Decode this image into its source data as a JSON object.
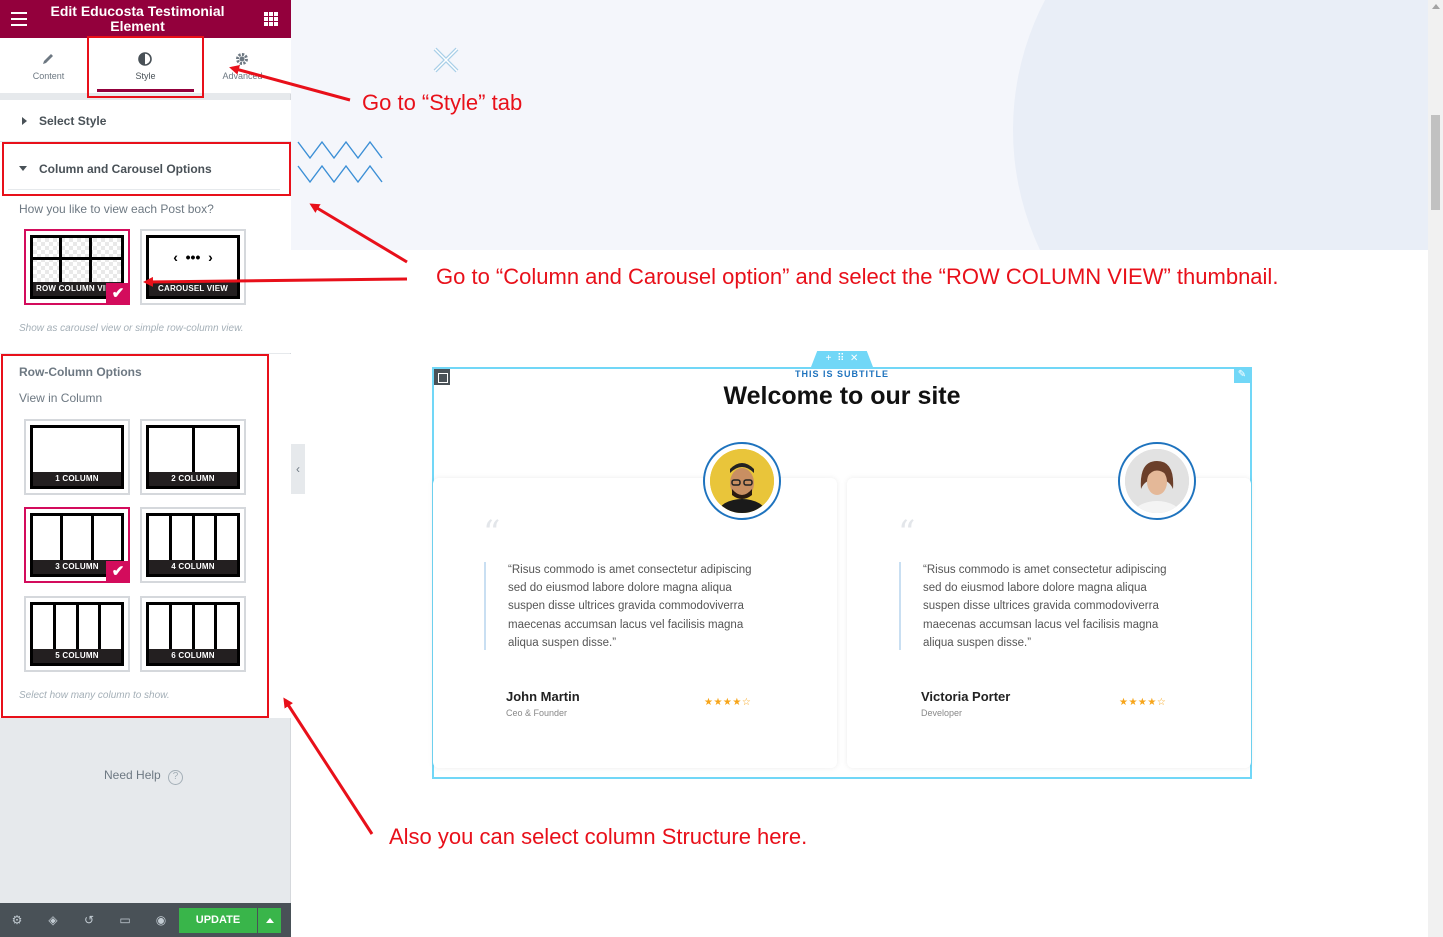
{
  "panel": {
    "title": "Edit Educosta Testimonial Element",
    "tabs": [
      {
        "label": "Content",
        "icon": "pencil-icon"
      },
      {
        "label": "Style",
        "icon": "half-circle-icon"
      },
      {
        "label": "Advanced",
        "icon": "gear-icon"
      }
    ],
    "select_style_label": "Select Style",
    "column_carousel_label": "Column and Carousel Options",
    "view_question": "How you like to view each Post box?",
    "view_options": [
      {
        "label": "ROW COLUMN VIEW",
        "selected": true
      },
      {
        "label": "CAROUSEL VIEW",
        "selected": false
      }
    ],
    "view_hint": "Show as carousel view or simple row-column view.",
    "row_column_label": "Row-Column Options",
    "view_in_column_label": "View in Column",
    "column_options": [
      {
        "label": "1 COLUMN",
        "cols": 1,
        "selected": false
      },
      {
        "label": "2 COLUMN",
        "cols": 2,
        "selected": false
      },
      {
        "label": "3 COLUMN",
        "cols": 3,
        "selected": true
      },
      {
        "label": "4 COLUMN",
        "cols": 4,
        "selected": false
      },
      {
        "label": "5 COLUMN",
        "cols": 4,
        "selected": false
      },
      {
        "label": "6 COLUMN",
        "cols": 4,
        "selected": false
      }
    ],
    "column_hint": "Select how many column to show.",
    "need_help": "Need Help",
    "update_label": "UPDATE",
    "footer_icons": [
      "settings-icon",
      "layers-icon",
      "history-icon",
      "responsive-icon",
      "eye-icon"
    ]
  },
  "preview": {
    "subtitle": "THIS IS SUBTITLE",
    "heading": "Welcome to our site",
    "testimonials": [
      {
        "quote": "“Risus commodo is amet consectetur adipiscing sed do eiusmod labore dolore magna aliqua suspen disse ultrices gravida commodoviverra maecenas accumsan lacus vel facilisis magna aliqua suspen disse.”",
        "name": "John Martin",
        "role": "Ceo & Founder",
        "rating": 4
      },
      {
        "quote": "“Risus commodo is amet consectetur adipiscing sed do eiusmod labore dolore magna aliqua suspen disse ultrices gravida commodoviverra maecenas accumsan lacus vel facilisis magna aliqua suspen disse.”",
        "name": "Victoria Porter",
        "role": "Developer",
        "rating": 4
      }
    ],
    "stars_text": "★★★★☆"
  },
  "annotations": {
    "style_tab": "Go  to “Style” tab",
    "column_option": "Go to “Column and Carousel option” and select the “ROW COLUMN VIEW” thumbnail.",
    "column_structure": "Also you can select column Structure here."
  },
  "colors": {
    "header": "#93003c",
    "selected": "#d30c5c",
    "annotation": "#e8101a",
    "update": "#39b54a",
    "accent": "#1e73be"
  }
}
